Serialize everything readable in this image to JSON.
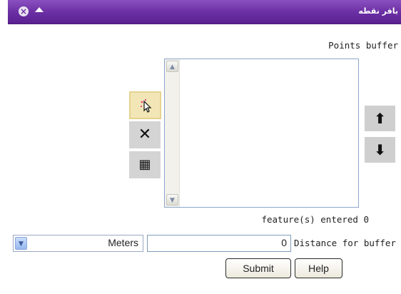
{
  "window": {
    "title": "بافر نقطه",
    "close_icon": "close-circle-icon",
    "collapse_icon": "collapse-up-icon",
    "accent": "#6a2ea3"
  },
  "panel": {
    "points_label": "Points buffer",
    "count_label": "feature(s) entered 0",
    "tools": [
      {
        "name": "select-point-tool",
        "icon": "pointer-sparkle-icon",
        "glyph": "⛯"
      },
      {
        "name": "clear-tool",
        "icon": "close-x-icon",
        "glyph": "✕"
      },
      {
        "name": "table-tool",
        "icon": "table-grid-icon",
        "glyph": "▦"
      }
    ],
    "move_up_glyph": "🡅",
    "move_down_glyph": "🡇"
  },
  "form": {
    "unit_selected": "Meters",
    "distance_value": "0",
    "distance_label": "Distance for buffer",
    "submit_label": "Submit",
    "help_label": "Help"
  }
}
